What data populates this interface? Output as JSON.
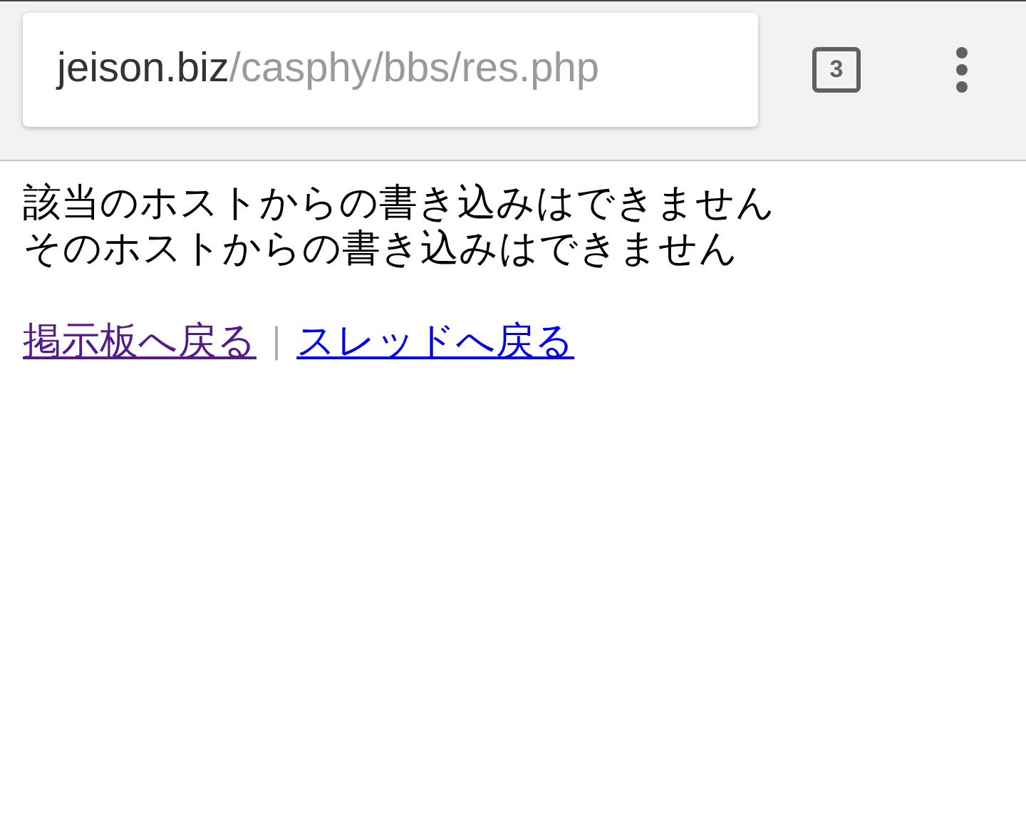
{
  "toolbar": {
    "url": {
      "domain": "jeison.biz",
      "path": "/casphy/bbs/res.php"
    },
    "tab_count": "3"
  },
  "messages": [
    "該当のホストからの書き込みはできません",
    "そのホストからの書き込みはできません"
  ],
  "links": [
    {
      "label": "掲示板へ戻る",
      "visited": true
    },
    {
      "label": "スレッドへ戻る",
      "visited": false
    }
  ],
  "separator": "|"
}
